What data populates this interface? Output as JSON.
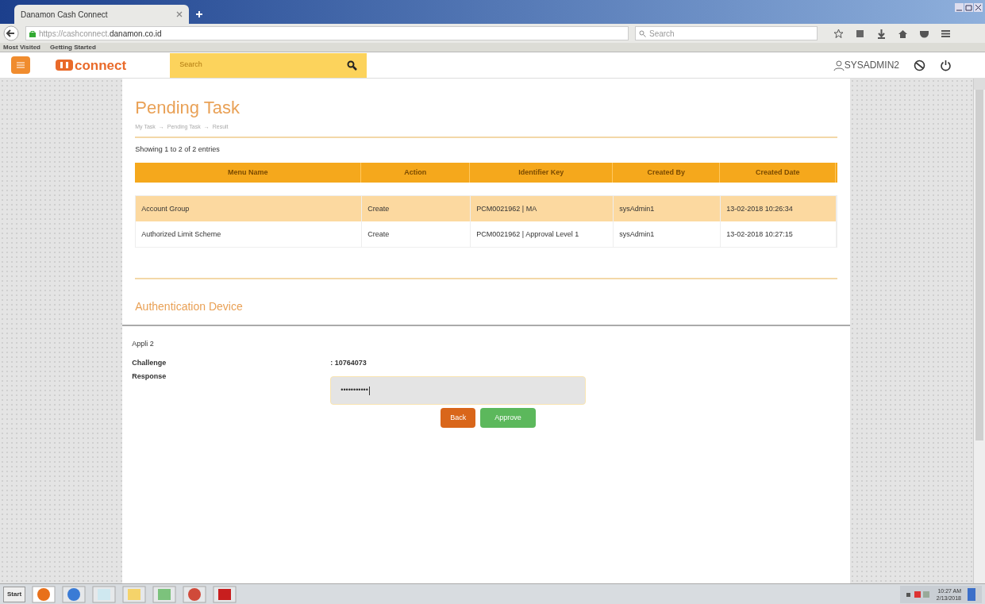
{
  "browser": {
    "tab_title": "Danamon Cash Connect",
    "url_prefix": "https://cashconnect.",
    "url_domain": "danamon.co.id",
    "search_placeholder": "Search",
    "bookmarks": [
      "Most Visited",
      "Getting Started"
    ]
  },
  "app_header": {
    "logo_text": "connect",
    "search_placeholder": "Search",
    "user": "SYSADMIN2"
  },
  "page": {
    "title": "Pending Task",
    "breadcrumb": [
      "My Task",
      "Pending Task",
      "Result"
    ],
    "breadcrumb_separator": "→",
    "entries_info": "Showing 1 to 2 of 2 entries"
  },
  "table": {
    "columns": [
      "Menu Name",
      "Action",
      "Identifier Key",
      "Created By",
      "Created Date"
    ],
    "rows": [
      {
        "selected": true,
        "cells": [
          "Account Group",
          "Create",
          "PCM0021962 | MA",
          "sysAdmin1",
          "13-02-2018 10:26:34"
        ]
      },
      {
        "selected": false,
        "cells": [
          "Authorized Limit Scheme",
          "Create",
          "PCM0021962 | Approval Level 1",
          "sysAdmin1",
          "13-02-2018 10:27:15"
        ]
      }
    ]
  },
  "auth": {
    "title": "Authentication Device",
    "device": "Appli 2",
    "challenge_label": "Challenge",
    "challenge_value": ": 10764073",
    "response_label": "Response",
    "response_value": "•••••••••••",
    "buttons": [
      "Back",
      "Approve"
    ]
  },
  "taskbar": {
    "start": "Start",
    "time": "10:27 AM",
    "date": "2/13/2018"
  }
}
